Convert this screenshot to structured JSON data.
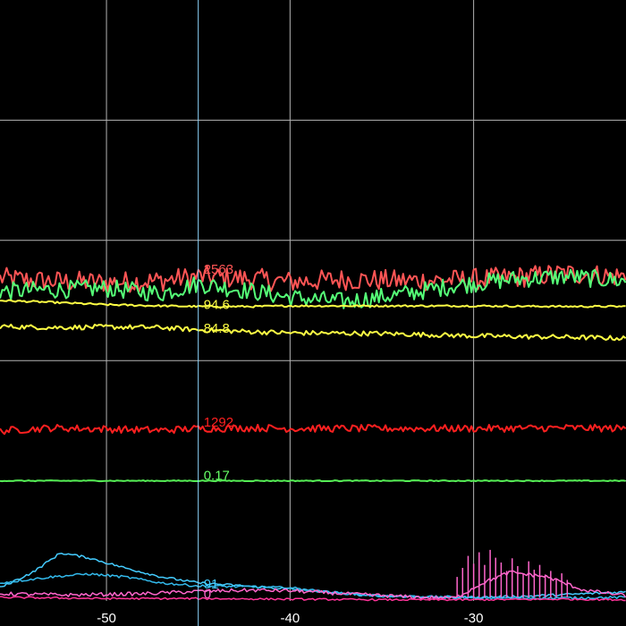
{
  "chart_data": {
    "type": "line",
    "title": "",
    "xlabel": "",
    "ylabel": "",
    "xlim": [
      -55.8,
      -21.7
    ],
    "ylim": [
      0,
      1
    ],
    "grid": true,
    "background": "#000000",
    "grid_color": "#b4b4b4",
    "cursor": {
      "x": -45,
      "color": "#8fd8ff"
    },
    "x_ticks": [
      {
        "value": -50,
        "label": "-50"
      },
      {
        "value": -40,
        "label": "-40"
      },
      {
        "value": -30,
        "label": "-30"
      }
    ],
    "cursor_values": [
      {
        "label": "2563",
        "color": "#ff5555",
        "series": "red-top"
      },
      {
        "label": "94.6",
        "color": "#ffff44",
        "series": "yellow-upper"
      },
      {
        "label": "84.8",
        "color": "#ffff44",
        "series": "yellow-lower"
      },
      {
        "label": "1292",
        "color": "#ff2020",
        "series": "red-mid"
      },
      {
        "label": "0.17",
        "color": "#66ff66",
        "series": "green-flat"
      },
      {
        "label": "91",
        "color": "#44ccff",
        "series": "cyan"
      },
      {
        "label": "0",
        "color": "#ff66cc",
        "series": "pink"
      }
    ],
    "series": [
      {
        "id": "red-top",
        "color": "#ff5555",
        "width": 2,
        "x": [
          -55.8,
          -53,
          -50,
          -47,
          -45,
          -42,
          -40,
          -37,
          -34,
          -31,
          -28,
          -25,
          -21.7
        ],
        "y": [
          0.537,
          0.532,
          0.53,
          0.533,
          0.54,
          0.536,
          0.531,
          0.535,
          0.533,
          0.534,
          0.538,
          0.545,
          0.54
        ],
        "noise": 0.018
      },
      {
        "id": "green-top",
        "color": "#55ff77",
        "width": 2,
        "x": [
          -55.8,
          -53,
          -50,
          -47,
          -45,
          -42,
          -40,
          -37,
          -34,
          -31,
          -28,
          -25,
          -21.7
        ],
        "y": [
          0.515,
          0.518,
          0.52,
          0.512,
          0.528,
          0.515,
          0.505,
          0.498,
          0.51,
          0.525,
          0.535,
          0.54,
          0.532
        ],
        "noise": 0.015
      },
      {
        "id": "yellow-upper",
        "color": "#ffff44",
        "width": 2,
        "x": [
          -55.8,
          -53,
          -50,
          -47,
          -45,
          -42,
          -40,
          -35,
          -30,
          -25,
          -21.7
        ],
        "y": [
          0.5,
          0.497,
          0.493,
          0.491,
          0.49,
          0.49,
          0.491,
          0.491,
          0.491,
          0.49,
          0.49
        ],
        "noise": 0.0015
      },
      {
        "id": "yellow-lower",
        "color": "#ffff44",
        "width": 2,
        "x": [
          -55.8,
          -53,
          -50,
          -47,
          -45,
          -42,
          -40,
          -35,
          -30,
          -25,
          -21.7
        ],
        "y": [
          0.457,
          0.455,
          0.456,
          0.455,
          0.451,
          0.448,
          0.446,
          0.445,
          0.441,
          0.439,
          0.437
        ],
        "noise": 0.004
      },
      {
        "id": "red-mid",
        "color": "#ff2020",
        "width": 2,
        "x": [
          -55.8,
          -53,
          -50,
          -47,
          -45,
          -42,
          -40,
          -35,
          -30,
          -25,
          -21.7
        ],
        "y": [
          0.283,
          0.288,
          0.286,
          0.284,
          0.287,
          0.288,
          0.287,
          0.287,
          0.287,
          0.288,
          0.287
        ],
        "noise": 0.006
      },
      {
        "id": "green-flat",
        "color": "#55ee55",
        "width": 2,
        "x": [
          -55.8,
          -40,
          -21.7
        ],
        "y": [
          0.2,
          0.2,
          0.2
        ],
        "noise": 0.0008
      },
      {
        "id": "cyan",
        "color": "#44ccff",
        "width": 1.5,
        "x": [
          -55.8,
          -54,
          -52.5,
          -51,
          -49,
          -47,
          -45,
          -43,
          -40,
          -38,
          -36,
          -33,
          -30,
          -27,
          -24,
          -21.7
        ],
        "y": [
          0.022,
          0.048,
          0.08,
          0.072,
          0.055,
          0.04,
          0.03,
          0.026,
          0.02,
          0.015,
          0.01,
          0.007,
          0.006,
          0.008,
          0.012,
          0.015
        ],
        "noise": 0.002
      },
      {
        "id": "cyan-2",
        "color": "#33bbee",
        "width": 1.5,
        "x": [
          -55.8,
          -53,
          -51,
          -49,
          -47,
          -45,
          -43,
          -40,
          -38,
          -35,
          -30,
          -25,
          -21.7
        ],
        "y": [
          0.03,
          0.04,
          0.045,
          0.04,
          0.03,
          0.025,
          0.024,
          0.022,
          0.015,
          0.008,
          0.005,
          0.005,
          0.006
        ],
        "noise": 0.002
      },
      {
        "id": "pink",
        "color": "#ff66cc",
        "width": 1.5,
        "x": [
          -55.8,
          -52,
          -48,
          -45,
          -42,
          -40,
          -37,
          -33,
          -31,
          -29.5,
          -28,
          -26,
          -24,
          -22,
          -21.7
        ],
        "y": [
          0.012,
          0.01,
          0.012,
          0.016,
          0.018,
          0.017,
          0.012,
          0.006,
          0.005,
          0.03,
          0.048,
          0.04,
          0.018,
          0.01,
          0.009
        ],
        "noise": 0.003
      },
      {
        "id": "pink-2",
        "color": "#ff3399",
        "width": 1.5,
        "x": [
          -55.8,
          -50,
          -45,
          -40,
          -35,
          -30,
          -25,
          -21.7
        ],
        "y": [
          0.006,
          0.004,
          0.004,
          0.003,
          0.002,
          0.002,
          0.003,
          0.002
        ],
        "noise": 0.0015
      }
    ],
    "spikes": [
      {
        "series": "pink",
        "x": [
          -30.9,
          -30.6,
          -30.3,
          -30.0,
          -29.7,
          -29.4,
          -29.1,
          -28.8,
          -28.5,
          -28.2,
          -27.9,
          -27.6,
          -27.3,
          -27.0,
          -26.7,
          -26.4,
          -26.1,
          -25.8,
          -25.5,
          -25.2,
          -24.9
        ],
        "y": [
          0.04,
          0.055,
          0.075,
          0.062,
          0.081,
          0.06,
          0.085,
          0.072,
          0.064,
          0.05,
          0.071,
          0.058,
          0.046,
          0.066,
          0.052,
          0.06,
          0.044,
          0.05,
          0.038,
          0.046,
          0.035
        ]
      }
    ]
  }
}
